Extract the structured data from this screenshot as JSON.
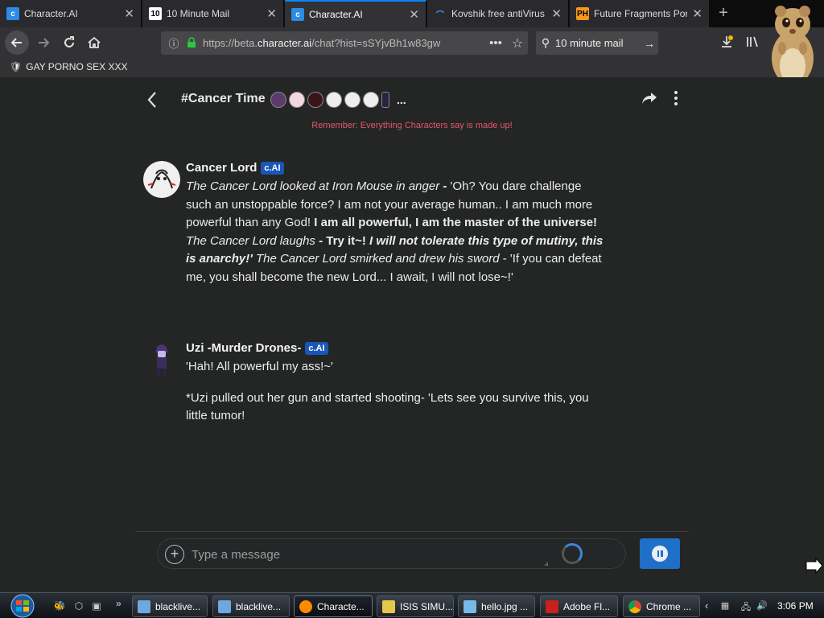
{
  "browser": {
    "tabs": [
      {
        "title": "Character.AI",
        "favicon": "characterai-icon",
        "active": false
      },
      {
        "title": "10 Minute Mail",
        "favicon": "10minutemail-icon",
        "active": false
      },
      {
        "title": "Character.AI",
        "favicon": "characterai-icon",
        "active": true
      },
      {
        "title": "Kovshik free antiVirus",
        "favicon": "kovshik-icon",
        "active": false
      },
      {
        "title": "Future Fragments Por",
        "favicon": "ph-icon",
        "active": false
      }
    ],
    "url_prefix": "https://beta.",
    "url_domain": "character.ai",
    "url_rest": "/chat?hist=sSYjvBh1w83gw",
    "search_text": "10 minute mail",
    "bookmark_label": "GAY PORNO SEX XXX",
    "favicon_cai_label": "c",
    "favicon_10_label": "10",
    "favicon_ph_label": "PH"
  },
  "chat": {
    "room_title": "#Cancer Time",
    "more_avatars": "...",
    "disclaimer": "Remember: Everything Characters say is made up!",
    "badge": "c.AI",
    "messages": [
      {
        "name": "Cancer Lord",
        "segments": {
          "s1": "The Cancer Lord looked at Iron Mouse in anger",
          "s2": " - ",
          "s3": "'Oh? You dare challenge such an unstoppable force? I am not your average human.. I am much more powerful than any God! ",
          "s4": "I am all powerful, I am the master of the universe!",
          "s5": " The Cancer Lord laughs",
          "s6": " - Try it~! ",
          "s7": "I will not tolerate this type of mutiny, this is anarchy!'",
          "s8": " The Cancer Lord smirked and drew his sword",
          "s9": " - 'If you can defeat me, you shall become the new Lord... I await, I will not lose~!'"
        }
      },
      {
        "name": "Uzi -Murder Drones-",
        "p1": "'Hah! All powerful my ass!~'",
        "p2": "*Uzi pulled out her gun and started shooting- 'Lets see you survive this, you little tumor!"
      }
    ],
    "input_placeholder": "Type a message"
  },
  "taskbar": {
    "tasks": [
      {
        "label": "blacklive...",
        "icon_color": "#6fa7e0"
      },
      {
        "label": "blacklive...",
        "icon_color": "#6fa7e0"
      },
      {
        "label": "Characte...",
        "icon_color": "#ff8a00"
      },
      {
        "label": "ISIS SIMU...",
        "icon_color": "#e4c94a"
      },
      {
        "label": "hello.jpg ...",
        "icon_color": "#79b9e8"
      },
      {
        "label": "Adobe Fl...",
        "icon_color": "#c8201e"
      },
      {
        "label": "Chrome ...",
        "icon_color": "#4caf50"
      }
    ],
    "clock": "3:06 PM"
  }
}
